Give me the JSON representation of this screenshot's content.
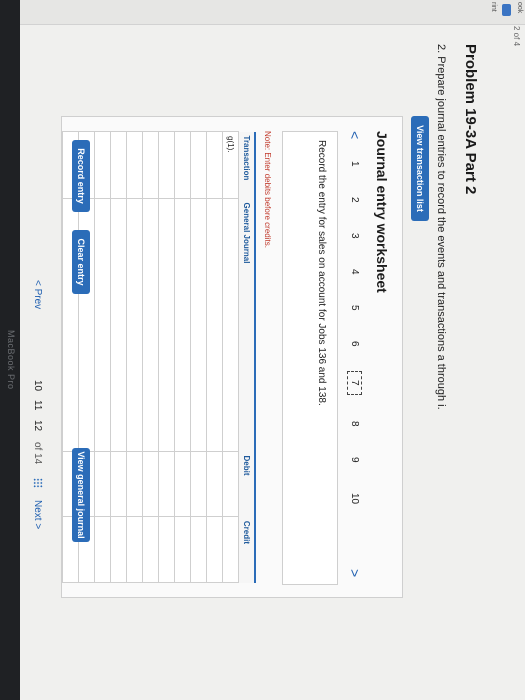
{
  "sidebar": {
    "book_label": "ook",
    "print_label": "rint"
  },
  "header": {
    "page_indicator": "2 of 4"
  },
  "problem": {
    "title": "Problem 19-3A Part 2",
    "instruction": "2. Prepare journal entries to record the events and transactions a through i."
  },
  "buttons": {
    "view_transaction_list": "View transaction list",
    "record_entry": "Record entry",
    "clear_entry": "Clear entry",
    "view_general_journal": "View general journal"
  },
  "worksheet": {
    "title": "Journal entry worksheet",
    "pages": [
      "1",
      "2",
      "3",
      "4",
      "5",
      "6",
      "7",
      "8",
      "9",
      "10"
    ],
    "current_page": "7",
    "prev_arrow": "<",
    "next_arrow": ">",
    "entry_text": "Record the entry for sales on account for Jobs 136 and 138.",
    "note": "Note: Enter debits before credits."
  },
  "journal_table": {
    "headers": {
      "transaction": "Transaction",
      "general_journal": "General Journal",
      "debit": "Debit",
      "credit": "Credit"
    },
    "first_row_label": "g(1)."
  },
  "pagination": {
    "prev": "< Prev",
    "pages": [
      "10",
      "11",
      "12"
    ],
    "of_total": "of 14",
    "next": "Next >"
  },
  "device": {
    "label": "MacBook Pro"
  }
}
